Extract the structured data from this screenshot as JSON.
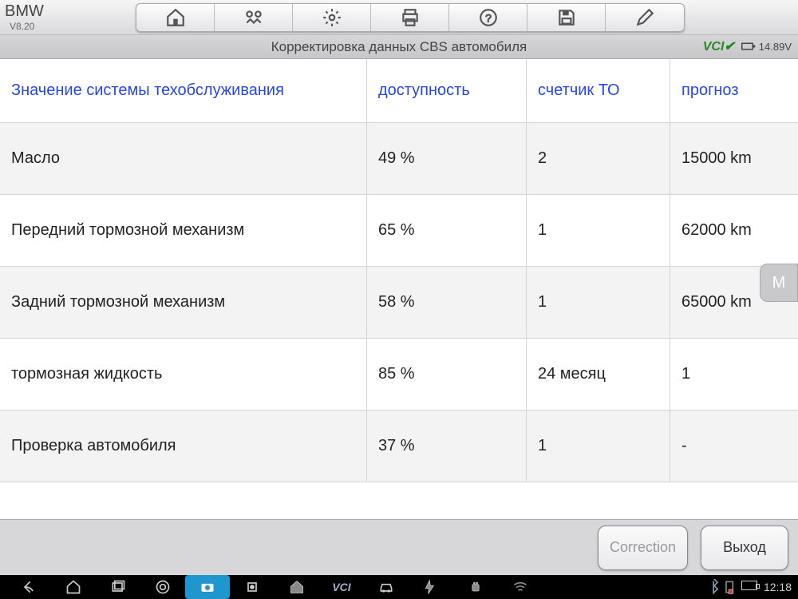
{
  "brand": "BMW",
  "version": "V8.20",
  "subtitle": "Корректировка данных CBS автомобиля",
  "vci_label": "VCI",
  "voltage": "14.89V",
  "header": {
    "c1": "Значение системы техобслуживания",
    "c2": "доступность",
    "c3": "счетчик ТО",
    "c4": "прогноз"
  },
  "rows": [
    {
      "c1": "Масло",
      "c2": "49 %",
      "c3": "2",
      "c4": "15000 km"
    },
    {
      "c1": "Передний тормозной механизм",
      "c2": "65 %",
      "c3": "1",
      "c4": "62000 km"
    },
    {
      "c1": "Задний тормозной механизм",
      "c2": "58 %",
      "c3": "1",
      "c4": "65000 km"
    },
    {
      "c1": "тормозная жидкость",
      "c2": "85 %",
      "c3": " 24 месяц",
      "c4": " 1"
    },
    {
      "c1": "Проверка автомобиля",
      "c2": "37 %",
      "c3": "1",
      "c4": "-"
    }
  ],
  "buttons": {
    "correction": "Correction",
    "exit": "Выход"
  },
  "clock": "12:18",
  "float_label": "M"
}
